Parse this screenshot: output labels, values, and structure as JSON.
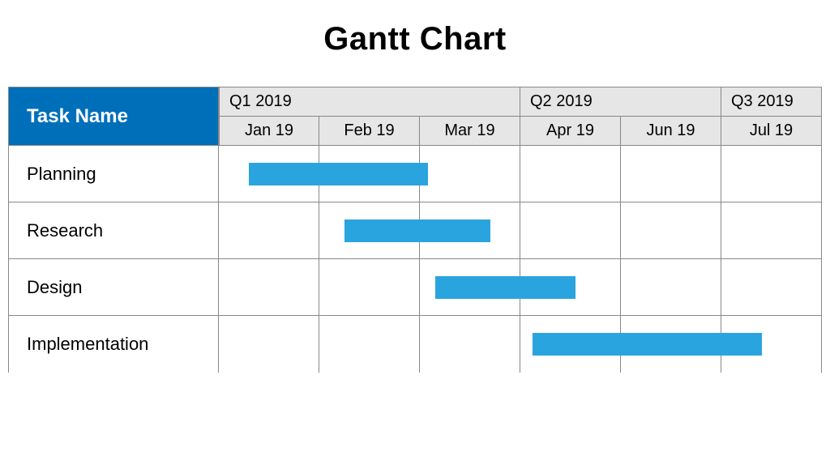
{
  "title": "Gantt Chart",
  "taskname_header": "Task Name",
  "quarters": [
    "Q1 2019",
    "Q2 2019",
    "Q3 2019"
  ],
  "months": [
    "Jan 19",
    "Feb 19",
    "Mar 19",
    "Apr 19",
    "Jun 19",
    "Jul 19"
  ],
  "tasks": [
    {
      "name": "Planning"
    },
    {
      "name": "Research"
    },
    {
      "name": "Design"
    },
    {
      "name": "Implementation"
    }
  ],
  "chart_data": {
    "type": "bar",
    "title": "Gantt Chart",
    "xlabel": "",
    "ylabel": "",
    "x_categories": [
      "Jan 19",
      "Feb 19",
      "Mar 19",
      "Apr 19",
      "Jun 19",
      "Jul 19"
    ],
    "x_groups": [
      {
        "label": "Q1 2019",
        "span": [
          "Jan 19",
          "Feb 19",
          "Mar 19"
        ]
      },
      {
        "label": "Q2 2019",
        "span": [
          "Apr 19",
          "Jun 19"
        ]
      },
      {
        "label": "Q3 2019",
        "span": [
          "Jul 19"
        ]
      }
    ],
    "xlim": [
      0,
      6
    ],
    "series": [
      {
        "name": "Planning",
        "start": 0.3,
        "end": 2.08
      },
      {
        "name": "Research",
        "start": 1.25,
        "end": 2.7
      },
      {
        "name": "Design",
        "start": 2.15,
        "end": 3.55
      },
      {
        "name": "Implementation",
        "start": 3.12,
        "end": 5.4
      }
    ]
  },
  "colors": {
    "header_blue": "#006fba",
    "bar_blue": "#2aa4de",
    "grid_grey": "#888888",
    "header_grey": "#e6e6e6"
  }
}
